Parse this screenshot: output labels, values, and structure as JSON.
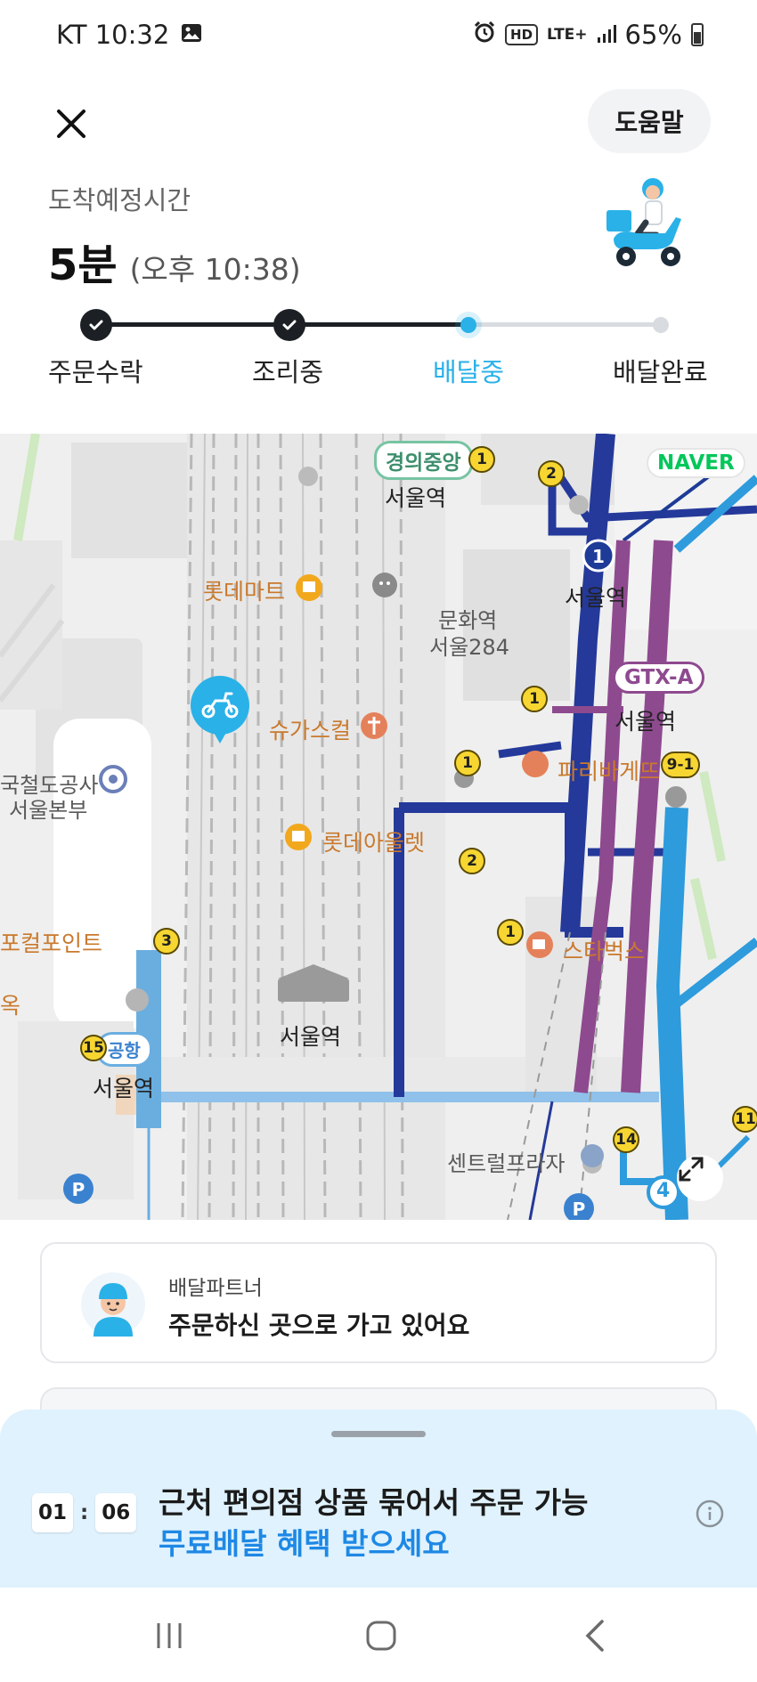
{
  "status_bar": {
    "carrier_time": "KT 10:32",
    "network": "LTE+",
    "hd": "HD",
    "battery": "65%"
  },
  "header": {
    "help_label": "도움말"
  },
  "eta": {
    "label": "도착예정시간",
    "minutes": "5분",
    "clock": "(오후 10:38)"
  },
  "progress": {
    "current_step": 3,
    "steps": [
      {
        "label": "주문수락",
        "state": "done"
      },
      {
        "label": "조리중",
        "state": "done"
      },
      {
        "label": "배달중",
        "state": "current"
      },
      {
        "label": "배달완료",
        "state": "pending"
      }
    ]
  },
  "map": {
    "provider": "NAVER",
    "labels": {
      "gyeongui": "경의중앙",
      "seoul_station_top": "서울역",
      "lotte_mart": "롯데마트",
      "culture_station": "문화역",
      "seoul284": "서울284",
      "seoul_station_line1": "서울역",
      "gtx_a": "GTX-A",
      "seoul_station_gtx": "서울역",
      "sugarscal": "슈가스컬",
      "paris_baguette": "파리바게뜨",
      "exit_9_1": "9-1",
      "korail_top": "국철도공사",
      "korail_bottom": "서울본부",
      "lotte_outlet": "롯데아울렛",
      "pocket_point": "포컬포인트",
      "starbucks": "스타벅스",
      "airport_tag": "공항",
      "seoul_station_airport": "서울역",
      "seoul_station_main": "서울역",
      "central_plaza": "센트럴프라자",
      "edge_text": "옥",
      "exit_14": "14",
      "exit_11": "11",
      "exit_15": "15",
      "line_4": "4"
    },
    "exits": [
      "1",
      "2",
      "1",
      "1",
      "1",
      "2",
      "1",
      "3"
    ]
  },
  "partner": {
    "role": "배달파트너",
    "message": "주문하신 곳으로 가고 있어요"
  },
  "promo": {
    "timer_minutes": "01",
    "timer_seconds": "06",
    "timer_sep": ":",
    "title": "근처 편의점 상품 묶어서 주문 가능",
    "subtitle": "무료배달 혜택 받으세요"
  },
  "colors": {
    "accent": "#2ab1e8",
    "line1": "#1e3b97",
    "gtx": "#8e4a8f",
    "airport": "#6aaee0",
    "line4": "#2e9bdc",
    "gyeongui": "#77c4a3",
    "promo_bg": "#dff2fd",
    "promo_accent": "#1e88e5"
  }
}
